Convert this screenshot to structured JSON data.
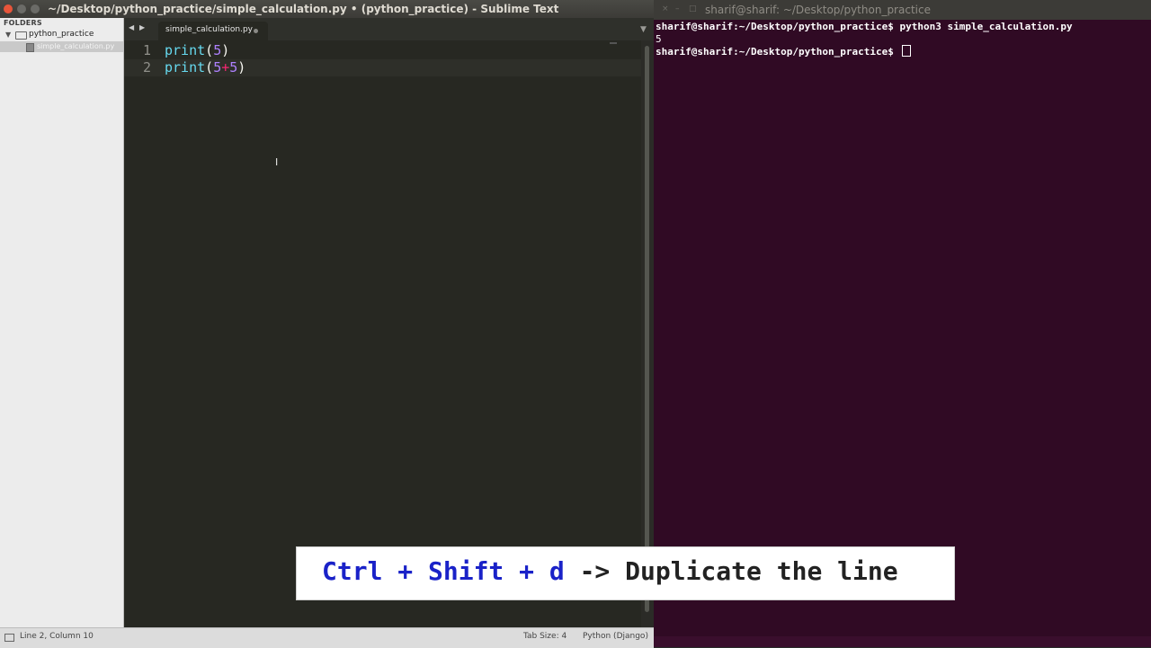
{
  "sublime": {
    "title": "~/Desktop/python_practice/simple_calculation.py • (python_practice) - Sublime Text",
    "sidebar": {
      "header": "FOLDERS",
      "folder": "python_practice",
      "file": "simple_calculation.py"
    },
    "tab": {
      "label": "simple_calculation.py"
    },
    "editor": {
      "lines": [
        {
          "num": "1",
          "kw": "print",
          "open": "(",
          "a": "5",
          "op": "",
          "b": "",
          "close": ")"
        },
        {
          "num": "2",
          "kw": "print",
          "open": "(",
          "a": "5",
          "op": "+",
          "b": "5",
          "close": ")"
        }
      ],
      "mouse_cursor": "I"
    },
    "status": {
      "position": "Line 2, Column 10",
      "tab_size": "Tab Size: 4",
      "syntax": "Python (Django)"
    }
  },
  "terminal": {
    "title": "sharif@sharif: ~/Desktop/python_practice",
    "prompt": "sharif@sharif:~/Desktop/python_practice$",
    "command": "python3 simple_calculation.py",
    "output": "5",
    "buttons": {
      "close": "×",
      "min": "–",
      "max": "□"
    }
  },
  "caption": {
    "keys": "Ctrl + Shift + d",
    "desc": " -> Duplicate the line"
  },
  "colors": {
    "editor_bg": "#272822",
    "keyword": "#66d9ef",
    "number": "#ae81ff",
    "operator": "#f92672",
    "terminal_bg": "#300a24",
    "caption_keys": "#1a22c8"
  }
}
